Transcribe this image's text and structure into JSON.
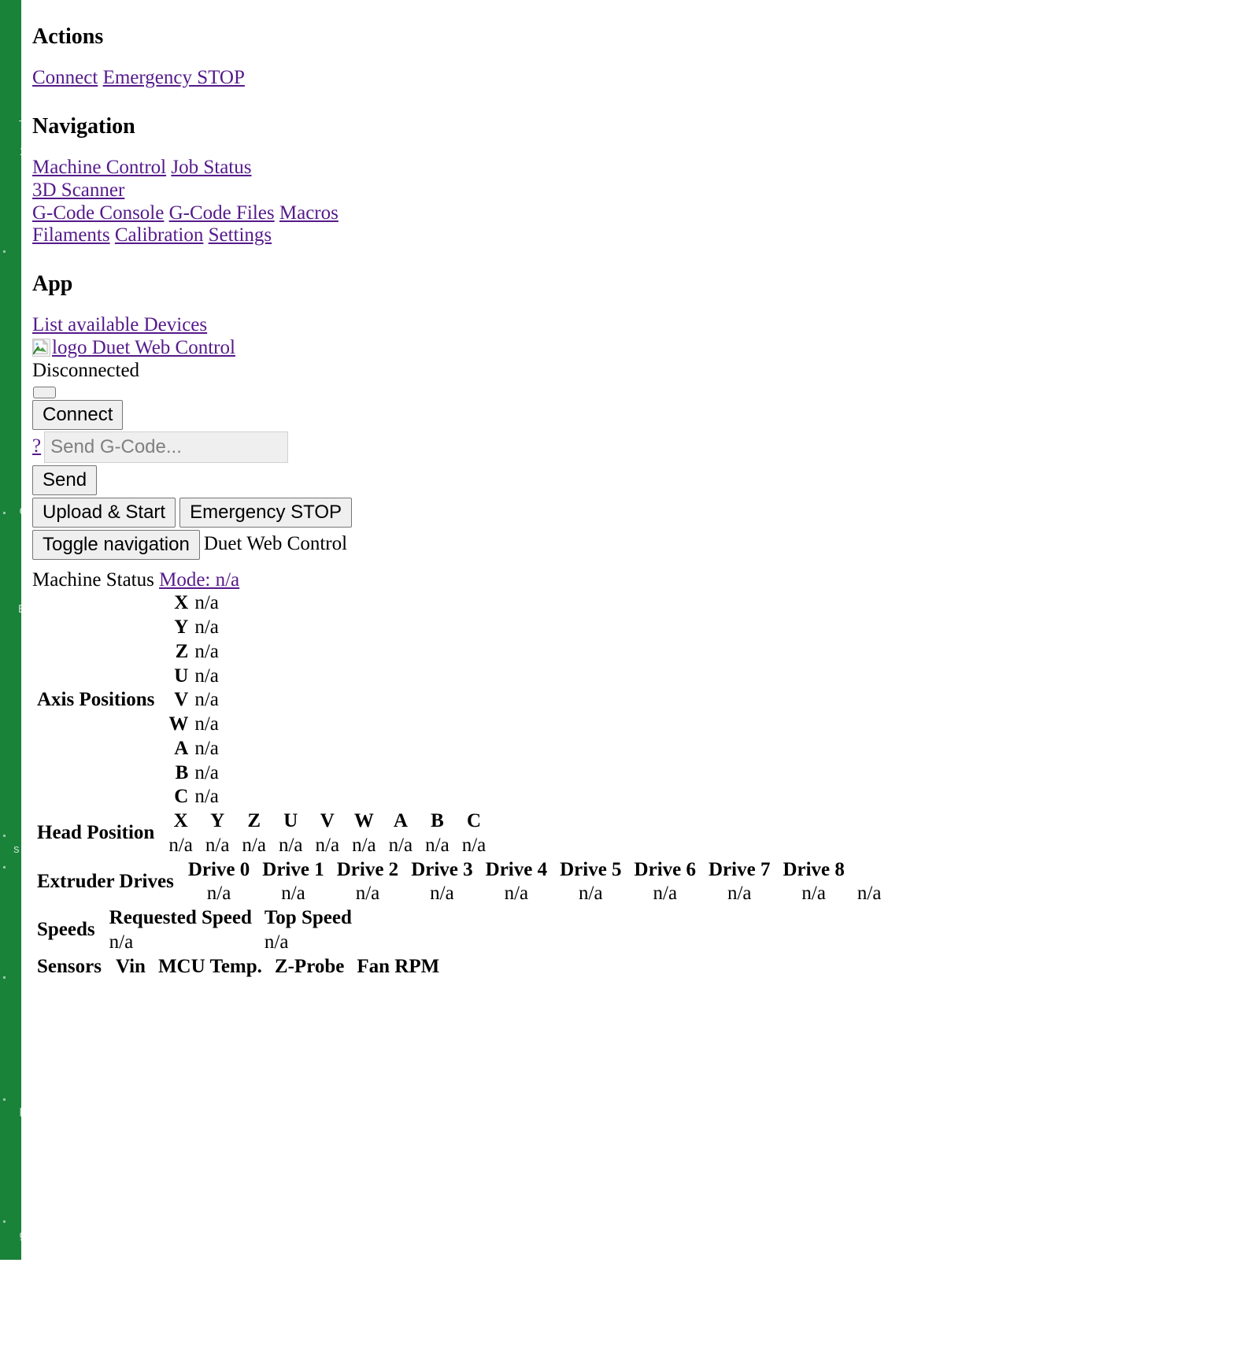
{
  "page": {
    "green_band_color": "#19833a",
    "link_color": "#551a8b"
  },
  "actions": {
    "heading": "Actions",
    "links": [
      "Connect",
      "Emergency STOP"
    ]
  },
  "navigation": {
    "heading": "Navigation",
    "line1": [
      "Machine Control",
      "Job Status"
    ],
    "line2": [
      "3D Scanner"
    ],
    "line3": [
      "G-Code Console",
      "G-Code Files",
      "Macros"
    ],
    "line4": [
      "Filaments",
      "Calibration",
      "Settings"
    ]
  },
  "app": {
    "heading": "App",
    "list_devices_link": "List available Devices",
    "logo_alt": "logo",
    "logo_link_text": "Duet Web Control",
    "connection_status": "Disconnected",
    "password_value": "",
    "connect_button": "Connect",
    "help_link": "?",
    "gcode_placeholder": "Send G-Code...",
    "gcode_value": "",
    "send_button": "Send",
    "upload_start_button": "Upload & Start",
    "emergency_stop_button": "Emergency STOP",
    "toggle_nav_button": "Toggle navigation",
    "brand": "Duet Web Control"
  },
  "machine_status": {
    "title": "Machine Status",
    "mode_link": "Mode: n/a",
    "axis_positions": {
      "label": "Axis Positions",
      "rows": [
        {
          "axis": "X",
          "value": "n/a"
        },
        {
          "axis": "Y",
          "value": "n/a"
        },
        {
          "axis": "Z",
          "value": "n/a"
        },
        {
          "axis": "U",
          "value": "n/a"
        },
        {
          "axis": "V",
          "value": "n/a"
        },
        {
          "axis": "W",
          "value": "n/a"
        },
        {
          "axis": "A",
          "value": "n/a"
        },
        {
          "axis": "B",
          "value": "n/a"
        },
        {
          "axis": "C",
          "value": "n/a"
        }
      ]
    },
    "head_position": {
      "label": "Head Position",
      "headers": [
        "X",
        "Y",
        "Z",
        "U",
        "V",
        "W",
        "A",
        "B",
        "C"
      ],
      "values": [
        "n/a",
        "n/a",
        "n/a",
        "n/a",
        "n/a",
        "n/a",
        "n/a",
        "n/a",
        "n/a"
      ]
    },
    "extruder_drives": {
      "label": "Extruder Drives",
      "headers": [
        "Drive 0",
        "Drive 1",
        "Drive 2",
        "Drive 3",
        "Drive 4",
        "Drive 5",
        "Drive 6",
        "Drive 7",
        "Drive 8"
      ],
      "values": [
        "n/a",
        "n/a",
        "n/a",
        "n/a",
        "n/a",
        "n/a",
        "n/a",
        "n/a",
        "n/a",
        "n/a"
      ]
    },
    "speeds": {
      "label": "Speeds",
      "headers": [
        "Requested Speed",
        "Top Speed"
      ],
      "values": [
        "n/a",
        "n/a"
      ]
    },
    "sensors": {
      "label": "Sensors",
      "headers": [
        "Vin",
        "MCU Temp.",
        "Z-Probe",
        "Fan RPM"
      ]
    }
  }
}
